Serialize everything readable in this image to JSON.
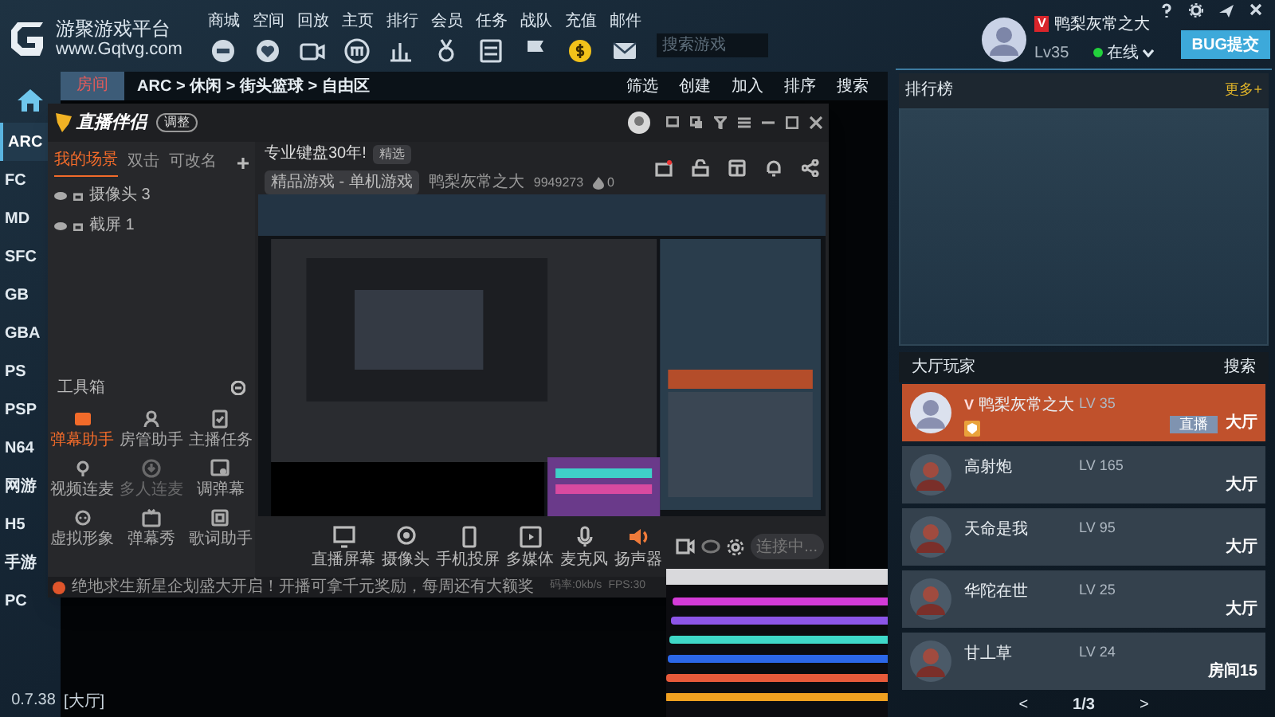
{
  "brand": {
    "title": "游聚游戏平台",
    "url": "www.Gqtvg.com"
  },
  "nav": [
    {
      "label": "商城"
    },
    {
      "label": "空间"
    },
    {
      "label": "回放"
    },
    {
      "label": "主页"
    },
    {
      "label": "排行"
    },
    {
      "label": "会员"
    },
    {
      "label": "任务"
    },
    {
      "label": "战队"
    },
    {
      "label": "充值"
    },
    {
      "label": "邮件"
    }
  ],
  "search": {
    "placeholder": "搜索游戏"
  },
  "user": {
    "vip": "V",
    "name": "鸭梨灰常之大",
    "level": "Lv35",
    "status": "在线",
    "online": true
  },
  "bug_button": "BUG提交",
  "sidebar": [
    {
      "label": "ARC",
      "selected": true
    },
    {
      "label": "FC",
      "selected": false
    },
    {
      "label": "MD",
      "selected": false
    },
    {
      "label": "SFC",
      "selected": false
    },
    {
      "label": "GB",
      "selected": false
    },
    {
      "label": "GBA",
      "selected": false
    },
    {
      "label": "PS",
      "selected": false
    },
    {
      "label": "PSP",
      "selected": false
    },
    {
      "label": "N64",
      "selected": false
    },
    {
      "label": "网游",
      "selected": false
    },
    {
      "label": "H5",
      "selected": false
    },
    {
      "label": "手游",
      "selected": false
    },
    {
      "label": "PC",
      "selected": false
    }
  ],
  "version": "0.7.38",
  "breadcrumb": {
    "tab": "房间",
    "path": "ARC > 休闲 > 街头篮球 > 自由区",
    "actions": [
      "筛选",
      "创建",
      "加入",
      "排序",
      "搜索"
    ]
  },
  "location": "[大厅]",
  "ranking": {
    "title": "排行榜",
    "more": "更多+"
  },
  "lobby": {
    "title": "大厅玩家",
    "search": "搜索",
    "page": "1/3",
    "prev": "<",
    "next": ">",
    "players": [
      {
        "vip": "V",
        "name": "鸭梨灰常之大",
        "level": "LV 35",
        "place": "大厅",
        "live": "直播",
        "selected": true
      },
      {
        "name": "高射炮",
        "level": "LV 165",
        "place": "大厅",
        "selected": false
      },
      {
        "name": "天命是我",
        "level": "LV 95",
        "place": "大厅",
        "selected": false
      },
      {
        "name": "华陀在世",
        "level": "LV 25",
        "place": "大厅",
        "selected": false
      },
      {
        "name": "甘丄草",
        "level": "LV 24",
        "place": "房间15",
        "selected": false
      }
    ]
  },
  "stream": {
    "app_name": "直播伴侣",
    "badge": "调整",
    "scene_tabs": [
      {
        "label": "我的场景",
        "selected": true
      },
      {
        "label": "双击",
        "selected": false
      },
      {
        "label": "可改名",
        "selected": false
      }
    ],
    "sources": [
      {
        "label": "摄像头 3"
      },
      {
        "label": "截屏 1"
      }
    ],
    "toolbox": {
      "title": "工具箱",
      "tools": [
        {
          "label": "弹幕助手",
          "selected": true,
          "disabled": false
        },
        {
          "label": "房管助手",
          "selected": false,
          "disabled": false
        },
        {
          "label": "主播任务",
          "selected": false,
          "disabled": false
        },
        {
          "label": "视频连麦",
          "selected": false,
          "disabled": false
        },
        {
          "label": "多人连麦",
          "selected": false,
          "disabled": true
        },
        {
          "label": "调弹幕",
          "selected": false,
          "disabled": false
        },
        {
          "label": "虚拟形象",
          "selected": false,
          "disabled": false
        },
        {
          "label": "弹幕秀",
          "selected": false,
          "disabled": false
        },
        {
          "label": "歌词助手",
          "selected": false,
          "disabled": false
        }
      ]
    },
    "room_title": "专业键盘30年!",
    "room_tag": "精选",
    "category": "精品游戏 - 单机游戏",
    "host": "鸭梨灰常之大",
    "room_id": "9949273",
    "popularity": "0",
    "controls": [
      {
        "label": "直播屏幕"
      },
      {
        "label": "摄像头"
      },
      {
        "label": "手机投屏"
      },
      {
        "label": "多媒体"
      },
      {
        "label": "麦克风"
      },
      {
        "label": "扬声器"
      }
    ],
    "start_button": "连接中...",
    "notice": "绝地求生新星企划盛大开启！开播可拿千元奖励，每周还有大额奖",
    "stats": [
      "码率:0kb/s",
      "FPS:30"
    ]
  }
}
